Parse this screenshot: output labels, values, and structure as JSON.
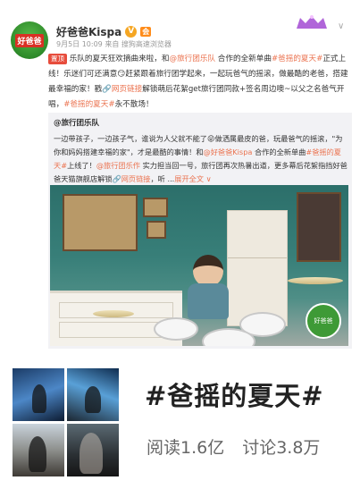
{
  "post": {
    "username": "好爸爸Kispa",
    "verified_icon": "V",
    "level_badge": "会",
    "meta": "9月5日 10:09 来自 搜狗高速浏览器",
    "tag_badge": "置顶",
    "content_parts": {
      "p1": "乐队的夏天狂欢摘曲来啦，和",
      "mention1": "@旅行团乐队",
      "p2": " 合作的全新单曲",
      "topic1": "#爸摇的夏天#",
      "p3": "正式上线！乐迷们可还满意",
      "p4": "赶紧跟着旅行团学起来，一起玩爸气的摇滚，做最酷的老爸，搭建最幸福的家！戳",
      "link1": "网页链接",
      "p5": "解锁萌后花絮get旅行团同款+签名周边噢~以父之名爸气开唱，",
      "topic2": "#爸摇的夏天#",
      "p6": "永不散场！"
    }
  },
  "repost": {
    "author": "@旅行团乐队",
    "parts": {
      "p1": "一边带孩子，一边孩子气，谁说为人父就不能了",
      "p2": "做洒属最皮的爸，玩最爸气的摇滚，\"为你和妈妈搭建幸福的家\"，才是最酷的事情！和",
      "mention1": "@好爸爸Kispa",
      "p3": " 合作的全新单曲",
      "topic1": "#爸摇的夏天#",
      "p4": "上线了！",
      "mention2": "@旅行团乐作",
      "p5": " 实力担当回一号，旅行团再次热暑出道，更多幕后花絮指挡好爸爸天猫旗舰店解锁",
      "link1": "网页链接",
      "p6": "，听 ...",
      "expand": "展开全文"
    }
  },
  "video": {
    "watermark": "好爸爸"
  },
  "topic_card": {
    "title": "#爸摇的夏天#",
    "reads": "阅读1.6亿",
    "discussions": "讨论3.8万"
  }
}
